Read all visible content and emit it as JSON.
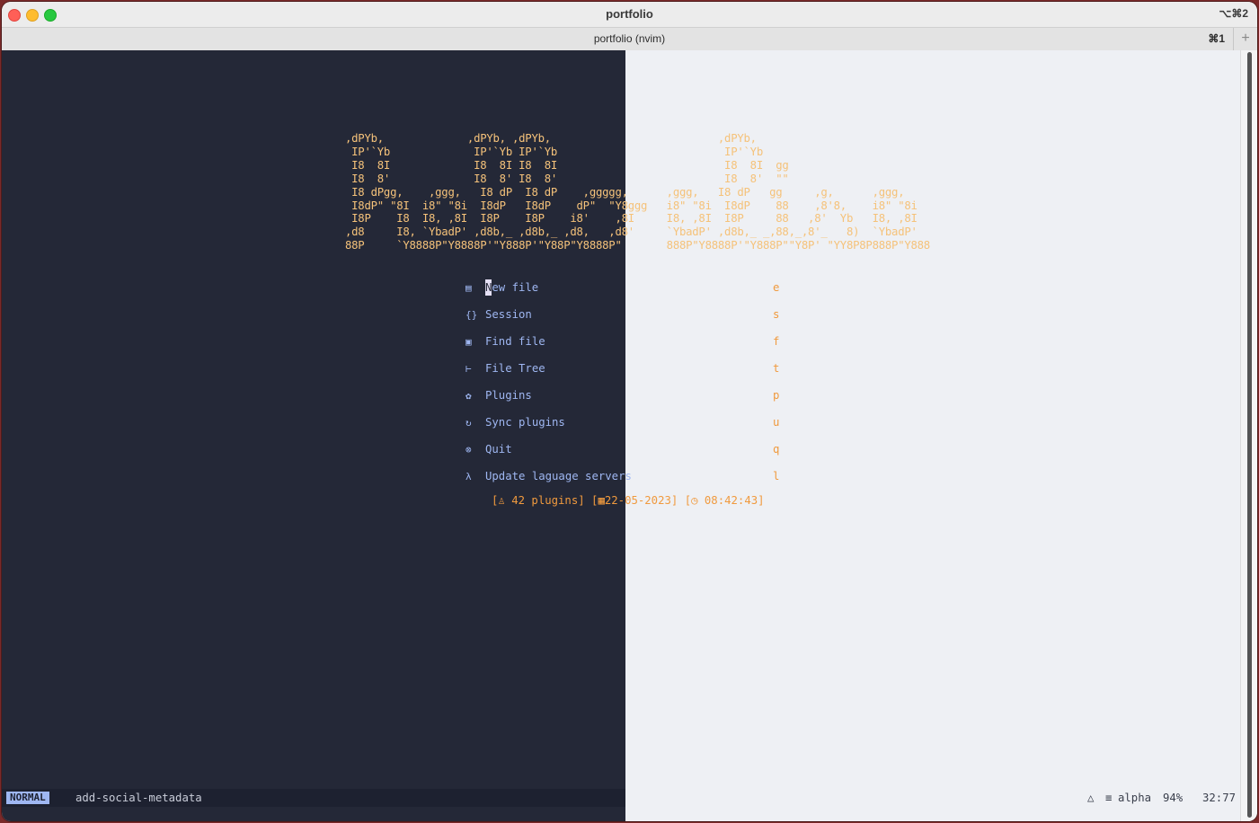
{
  "window": {
    "title": "portfolio",
    "shortcut": "⌥⌘2",
    "tab": {
      "label": "portfolio (nvim)",
      "shortcut": "⌘1",
      "add": "+"
    }
  },
  "dashboard": {
    "ascii_art": ",dPYb,             ,dPYb, ,dPYb,                          ,dPYb,\n IP'`Yb             IP'`Yb IP'`Yb                          IP'`Yb\n I8  8I             I8  8I I8  8I                          I8  8I  gg\n I8  8'             I8  8' I8  8'                          I8  8'  \"\"\n I8 dPgg,    ,ggg,   I8 dP  I8 dP    ,ggggg,      ,ggg,   I8 dP   gg     ,g,      ,ggg,\n I8dP\" \"8I  i8\" \"8i  I8dP   I8dP    dP\"  \"Y8ggg   i8\" \"8i  I8dP    88    ,8'8,    i8\" \"8i\n I8P    I8  I8, ,8I  I8P    I8P    i8'    ,8I     I8, ,8I  I8P     88   ,8'  Yb   I8, ,8I\n,d8     I8, `YbadP' ,d8b,_ ,d8b,_ ,d8,   ,d8'     `YbadP' ,d8b,_ _,88,_,8'_   8)  `YbadP'\n88P     `Y8888P\"Y8888P'\"Y888P'\"Y88P\"Y8888P\"       888P\"Y8888P'\"Y888P\"\"Y8P' \"YY8P8P888P\"Y888",
    "menu": [
      {
        "icon": "new-file-icon",
        "glyph": "▤",
        "cursor_char": "N",
        "label_rest": "ew file",
        "key": "e"
      },
      {
        "icon": "session-icon",
        "glyph": "{}",
        "cursor_char": "",
        "label_rest": "Session",
        "key": "s"
      },
      {
        "icon": "find-file-icon",
        "glyph": "▣",
        "cursor_char": "",
        "label_rest": "Find file",
        "key": "f"
      },
      {
        "icon": "file-tree-icon",
        "glyph": "⊢",
        "cursor_char": "",
        "label_rest": "File Tree",
        "key": "t"
      },
      {
        "icon": "plugins-gear-icon",
        "glyph": "✿",
        "cursor_char": "",
        "label_rest": "Plugins",
        "key": "p"
      },
      {
        "icon": "sync-icon",
        "glyph": "↻",
        "cursor_char": "",
        "label_rest": "Sync plugins",
        "key": "u"
      },
      {
        "icon": "quit-icon",
        "glyph": "⊗",
        "cursor_char": "",
        "label_rest": "Quit",
        "key": "q"
      },
      {
        "icon": "lambda-icon",
        "glyph": "λ",
        "cursor_char": "",
        "label_rest": "Update laguage servers",
        "key": "l"
      }
    ],
    "footer": "[♙ 42 plugins] [▦22-05-2023] [◷ 08:42:43]"
  },
  "statusline": {
    "mode": "NORMAL",
    "branch_icon": "",
    "branch": "add-social-metadata",
    "os_icon": "linux-icon",
    "os_glyph": "△",
    "filetype_glyph": "≡",
    "filetype": "alpha",
    "percent": "94%",
    "position": "32:77"
  },
  "colors": {
    "editor_bg": "#242837",
    "accent_blue": "#9fb7f2",
    "accent_orange": "#f09a3e",
    "ascii_yellow": "#f5c27a"
  }
}
